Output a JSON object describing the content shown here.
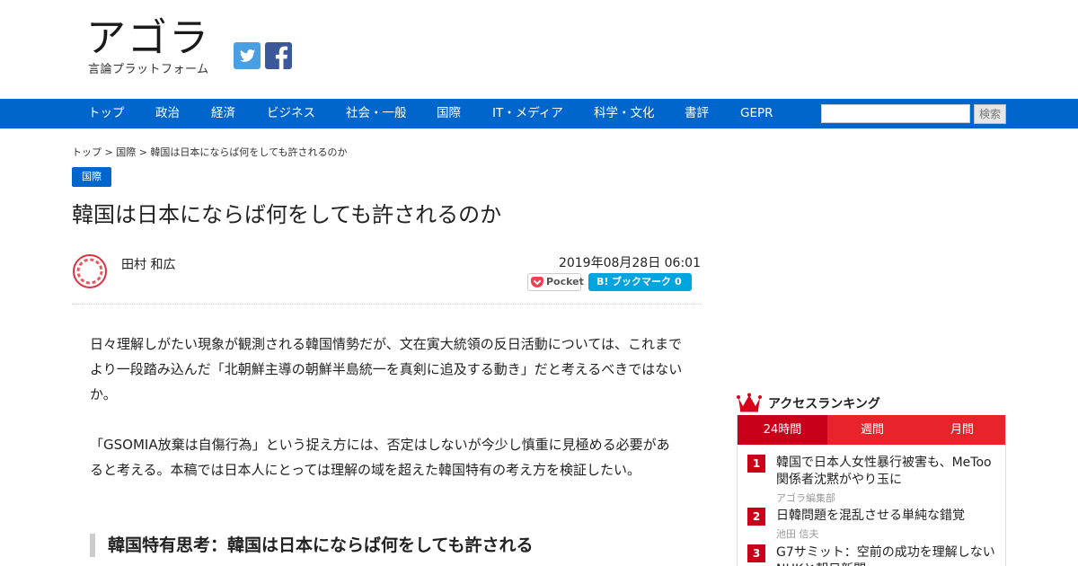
{
  "header": {
    "logo_main": "アゴラ",
    "logo_sub": "言論プラットフォーム",
    "twitter_icon": "twitter-icon",
    "facebook_icon": "facebook-icon"
  },
  "nav": {
    "items": [
      "トップ",
      "政治",
      "経済",
      "ビジネス",
      "社会・一般",
      "国際",
      "IT・メディア",
      "科学・文化",
      "書評",
      "GEPR"
    ],
    "search_placeholder": "",
    "search_button": "検索"
  },
  "breadcrumb": "トップ > 国際 > 韓国は日本にならば何をしても許されるのか",
  "category": "国際",
  "article": {
    "title": "韓国は日本にならば何をしても許されるのか",
    "author": "田村 和広",
    "date": "2019年08月28日 06:01",
    "pocket_label": "Pocket",
    "hatena_b": "B!",
    "hatena_label": "ブックマーク",
    "hatena_count": "0",
    "paragraphs": [
      "日々理解しがたい現象が観測される韓国情勢だが、文在寅大統領の反日活動については、これまでより一段踏み込んだ「北朝鮮主導の朝鮮半島統一を真剣に追及する動き」だと考えるべきではないか。",
      "「GSOMIA放棄は自傷行為」という捉え方には、否定はしないが今少し慎重に見極める必要があると考える。本稿では日本人にとっては理解の域を超えた韓国特有の考え方を検証したい。"
    ],
    "subheading": "韓国特有思考：韓国は日本にならば何をしても許される"
  },
  "ranking": {
    "title": "アクセスランキング",
    "tabs": [
      "24時間",
      "週間",
      "月間"
    ],
    "items": [
      {
        "rank": "1",
        "title": "韓国で日本人女性暴行被害も、MeToo関係者沈黙がやり玉に",
        "author": "アゴラ編集部"
      },
      {
        "rank": "2",
        "title": "日韓問題を混乱させる単純な錯覚",
        "author": "池田 信夫"
      },
      {
        "rank": "3",
        "title": "G7サミット：空前の成功を理解しないNHKと朝日新聞",
        "author": ""
      }
    ]
  },
  "colors": {
    "nav_bg": "#0066cc",
    "ranking_red": "#e8232b",
    "ranking_dark_red": "#c8001a",
    "hatena_blue": "#00a4de",
    "pocket_red": "#ef4056"
  }
}
